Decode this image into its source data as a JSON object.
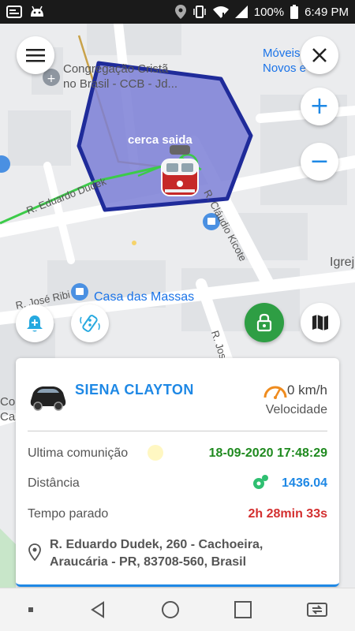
{
  "status_bar": {
    "battery": "100%",
    "time": "6:49 PM",
    "icons": [
      "gallery-icon",
      "android-icon",
      "location-icon",
      "vibrate-icon",
      "wifi-icon",
      "signal-icon",
      "battery-icon"
    ]
  },
  "map": {
    "labels": {
      "church": "Congregação Cristã\nno Brasil - CCB - Jd...",
      "moveis": "Móveis Seb\nNovos e U",
      "fence": "cerca saida",
      "street_dudek": "R. Eduardo Dudek",
      "street_kicote": "R. Cláudio Kicote",
      "street_ribi": "R. José Ribi",
      "street_jose": "R. José",
      "casa": "Casa das Massas",
      "igreja": "Igrej",
      "left_edge": "Con\nCas"
    },
    "fence_color": "#7b7fd6",
    "fence_border": "#1f2b9a"
  },
  "controls": {
    "menu": "menu-icon",
    "close": "close-icon",
    "zoom_in": "+",
    "zoom_out": "−",
    "alerts": "bell-plus-icon",
    "remote": "remote-control-icon",
    "lock": "lock-icon",
    "map_layers": "map-icon"
  },
  "card": {
    "vehicle_name": "SIENA  CLAYTON",
    "speed": "0 km/h",
    "speed_label": "Velocidade",
    "rows": [
      {
        "label": "Ultima comunição",
        "value": "18-09-2020 17:48:29",
        "color": "#1f8a1f"
      },
      {
        "label": "Distância",
        "value": "1436.04",
        "color": "#1e88e5"
      },
      {
        "label": "Tempo parado",
        "value": "2h 28min 33s",
        "color": "#d32f2f"
      }
    ],
    "address_line1": "R. Eduardo Dudek, 260 - Cachoeira,",
    "address_line2": "Araucária - PR, 83708-560, Brasil"
  },
  "nav_bar": [
    "square-dot-icon",
    "back-icon",
    "home-icon",
    "recents-icon",
    "screen-switch-icon"
  ]
}
